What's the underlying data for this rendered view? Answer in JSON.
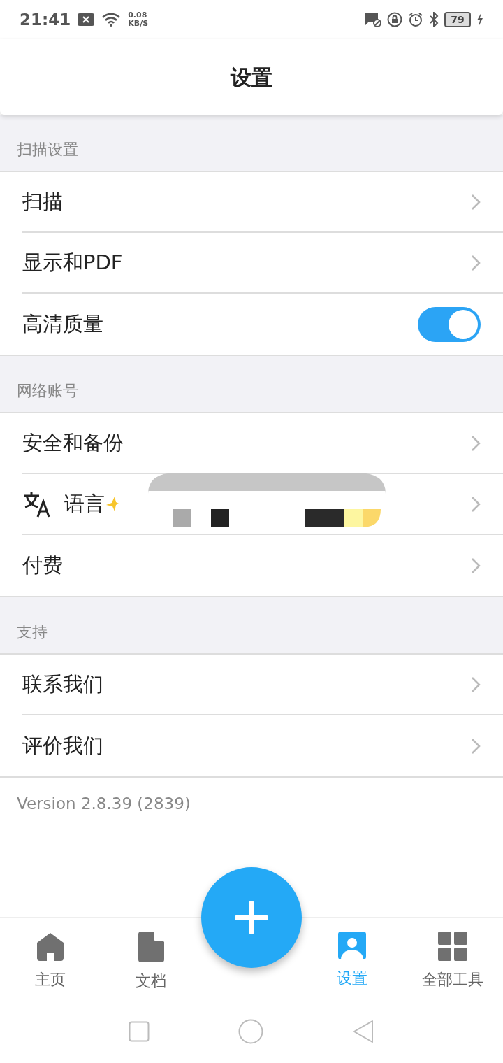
{
  "status_bar": {
    "time": "21:41",
    "net_speed_value": "0.08",
    "net_speed_unit": "KB/S",
    "battery": "79"
  },
  "title": "设置",
  "sections": [
    {
      "header": "扫描设置",
      "rows": [
        {
          "kind": "link",
          "label": "扫描"
        },
        {
          "kind": "link",
          "label": "显示和PDF"
        },
        {
          "kind": "toggle",
          "label": "高清质量",
          "on": true
        }
      ]
    },
    {
      "header": "网络账号",
      "rows": [
        {
          "kind": "link",
          "label": "安全和备份"
        },
        {
          "kind": "language",
          "label": "语言"
        },
        {
          "kind": "link",
          "label": "付费"
        }
      ]
    },
    {
      "header": "支持",
      "rows": [
        {
          "kind": "link",
          "label": "联系我们"
        },
        {
          "kind": "link",
          "label": "评价我们"
        }
      ]
    }
  ],
  "version": "Version 2.8.39 (2839)",
  "nav": [
    {
      "kind": "home",
      "label": "主页",
      "selected": false
    },
    {
      "kind": "doc",
      "label": "文档",
      "selected": false
    },
    {
      "kind": "fab"
    },
    {
      "kind": "settings",
      "label": "设置",
      "selected": true
    },
    {
      "kind": "tools",
      "label": "全部工具",
      "selected": false
    }
  ]
}
